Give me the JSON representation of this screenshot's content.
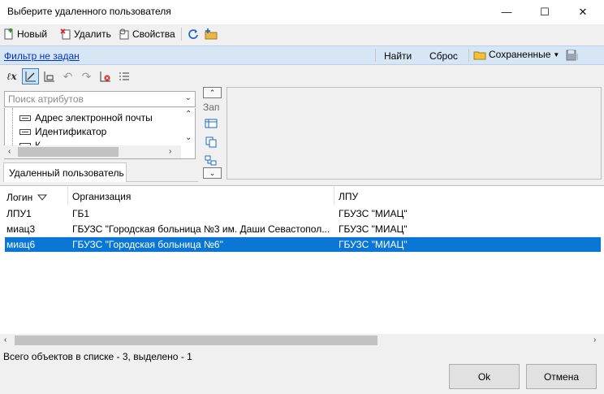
{
  "window": {
    "title": "Выберите удаленного пользователя",
    "minimize_glyph": "—",
    "maximize_glyph": "☐",
    "close_glyph": "✕"
  },
  "toolbar": {
    "new_label": "Новый",
    "delete_label": "Удалить",
    "properties_label": "Свойства"
  },
  "filterbar": {
    "filter_link": "Фильтр не задан",
    "find_label": "Найти",
    "reset_label": "Сброс",
    "saved_label": "Сохраненные"
  },
  "attributes": {
    "search_placeholder": "Поиск атрибутов",
    "items": [
      "Адрес электронной почты",
      "Идентификатор",
      "К"
    ],
    "tab_label": "Удаленный пользователь",
    "side_label": "Зап"
  },
  "grid": {
    "columns": [
      "Логин",
      "Организация",
      "ЛПУ"
    ],
    "rows": [
      {
        "login": "ЛПУ1",
        "org": "ГБ1",
        "lpu": "ГБУЗС \"МИАЦ\"",
        "selected": false
      },
      {
        "login": "миац3",
        "org": "ГБУЗС \"Городская больница №3 им. Даши Севастопол...",
        "lpu": "ГБУЗС \"МИАЦ\"",
        "selected": false
      },
      {
        "login": "миац6",
        "org": "ГБУЗС \"Городская больница №6\"",
        "lpu": "ГБУЗС \"МИАЦ\"",
        "selected": true
      }
    ]
  },
  "status": {
    "text": "Всего объектов в списке - 3, выделено - 1"
  },
  "buttons": {
    "ok_label": "Ok",
    "cancel_label": "Отмена"
  },
  "colors": {
    "selection": "#0a76d5",
    "filterbar": "#d6e6f5",
    "link": "#0033cc"
  }
}
